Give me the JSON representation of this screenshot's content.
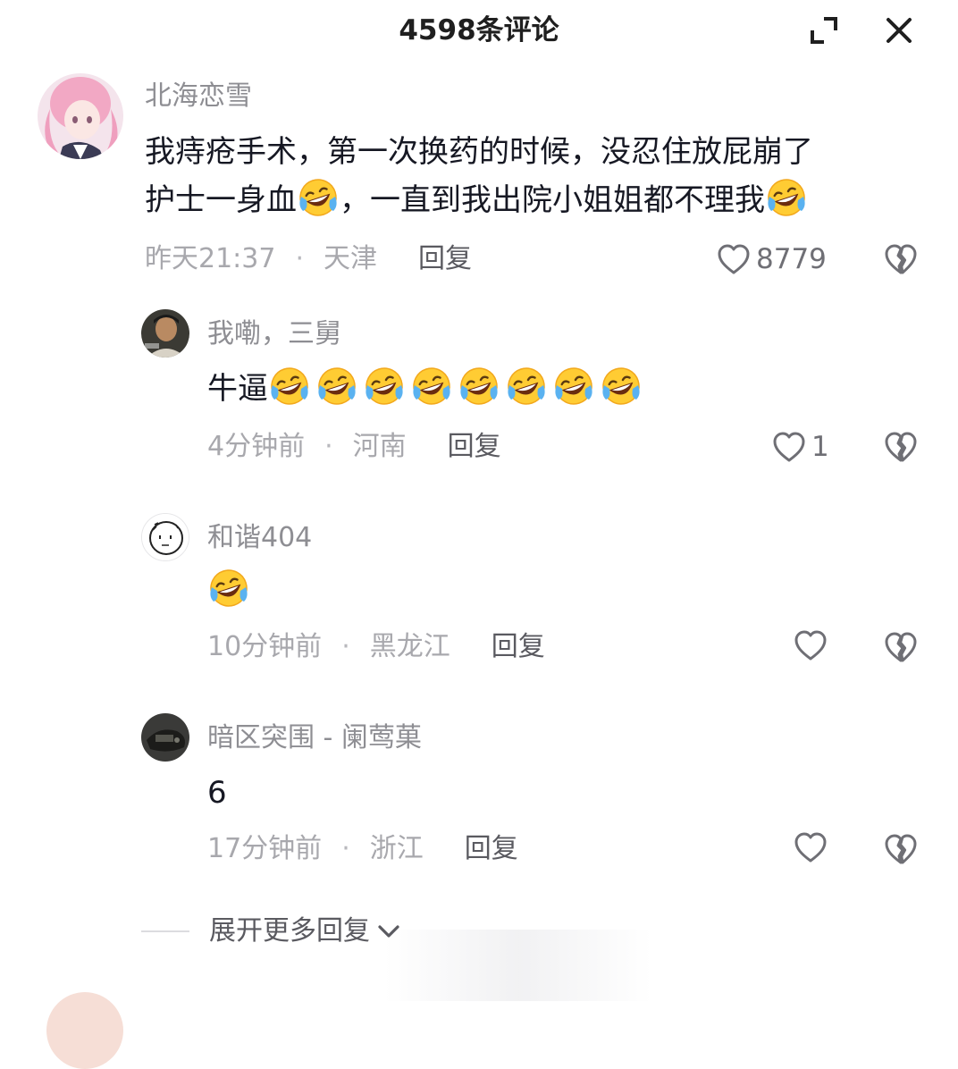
{
  "header": {
    "title": "4598条评论",
    "expand_icon": "expand-icon",
    "close_icon": "close-icon"
  },
  "comments": [
    {
      "username": "北海恋雪",
      "content_line1": "我痔疮手术，第一次换药的时候，没忍住放屁崩了",
      "content_line2_a": "护士一身血",
      "content_line2_b": "，一直到我出院小姐姐都不理我",
      "time": "昨天21:37",
      "separator": "·",
      "location": "天津",
      "reply_label": "回复",
      "likes": "8779"
    }
  ],
  "replies": [
    {
      "username": "我嘞，三舅",
      "content": "牛逼",
      "emoji_count": 8,
      "time": "4分钟前",
      "separator": "·",
      "location": "河南",
      "reply_label": "回复",
      "likes": "1"
    },
    {
      "username": "和谐404",
      "content": "",
      "emoji_count": 1,
      "time": "10分钟前",
      "separator": "·",
      "location": "黑龙江",
      "reply_label": "回复",
      "likes": ""
    },
    {
      "username": "暗区突围 - 阑莺菓",
      "content": "6",
      "emoji_count": 0,
      "time": "17分钟前",
      "separator": "·",
      "location": "浙江",
      "reply_label": "回复",
      "likes": ""
    }
  ],
  "expand_replies_label": "展开更多回复",
  "icons": {
    "like": "heart-outline-icon",
    "dislike": "broken-heart-icon",
    "emoji": "laughing-crying-emoji-icon"
  }
}
